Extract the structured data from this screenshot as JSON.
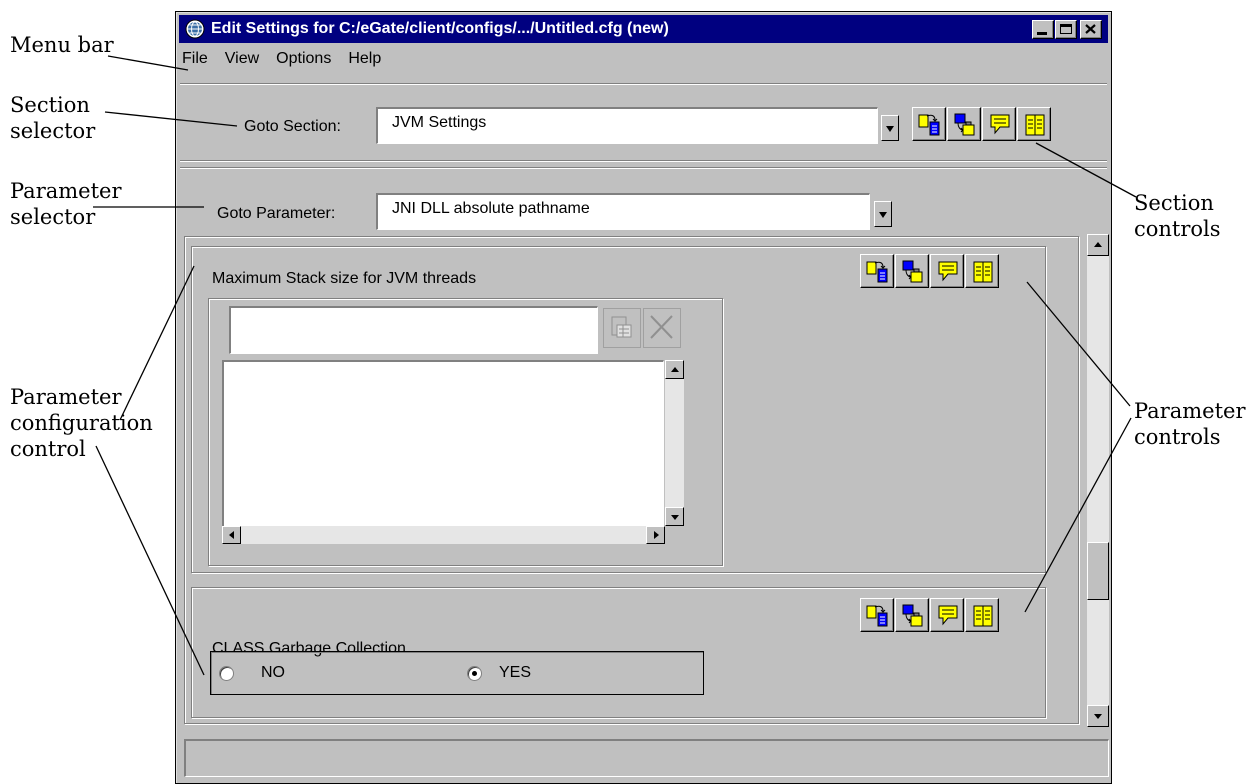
{
  "annotations": {
    "menu_bar": "Menu bar",
    "section_selector": [
      "Section",
      "selector"
    ],
    "parameter_selector": [
      "Parameter",
      "selector"
    ],
    "parameter_config_control": [
      "Parameter",
      "configuration",
      "control"
    ],
    "section_controls": [
      "Section",
      "controls"
    ],
    "parameter_controls": [
      "Parameter",
      "controls"
    ]
  },
  "window": {
    "title": "Edit Settings for C:/eGate/client/configs/.../Untitled.cfg (new)",
    "controls": [
      "minimize-icon",
      "maximize-icon",
      "close-icon"
    ]
  },
  "menu": [
    "File",
    "View",
    "Options",
    "Help"
  ],
  "goto_section": {
    "label": "Goto Section:",
    "value": "JVM Settings"
  },
  "goto_parameter": {
    "label": "Goto Parameter:",
    "value": "JNI DLL absolute pathname"
  },
  "toolbar_icons": [
    "copy-icon",
    "paste-icon",
    "comment-icon",
    "book-icon"
  ],
  "parameters": [
    {
      "title": "Maximum Stack size for JVM threads",
      "input_value": "",
      "list_items": []
    },
    {
      "title": "CLASS Garbage Collection",
      "options": [
        "NO",
        "YES"
      ],
      "selected": "YES"
    }
  ],
  "colors": {
    "titlebar": "#000080",
    "face": "#c0c0c0",
    "icon_yellow": "#ffff00",
    "icon_blue": "#0000ff"
  }
}
